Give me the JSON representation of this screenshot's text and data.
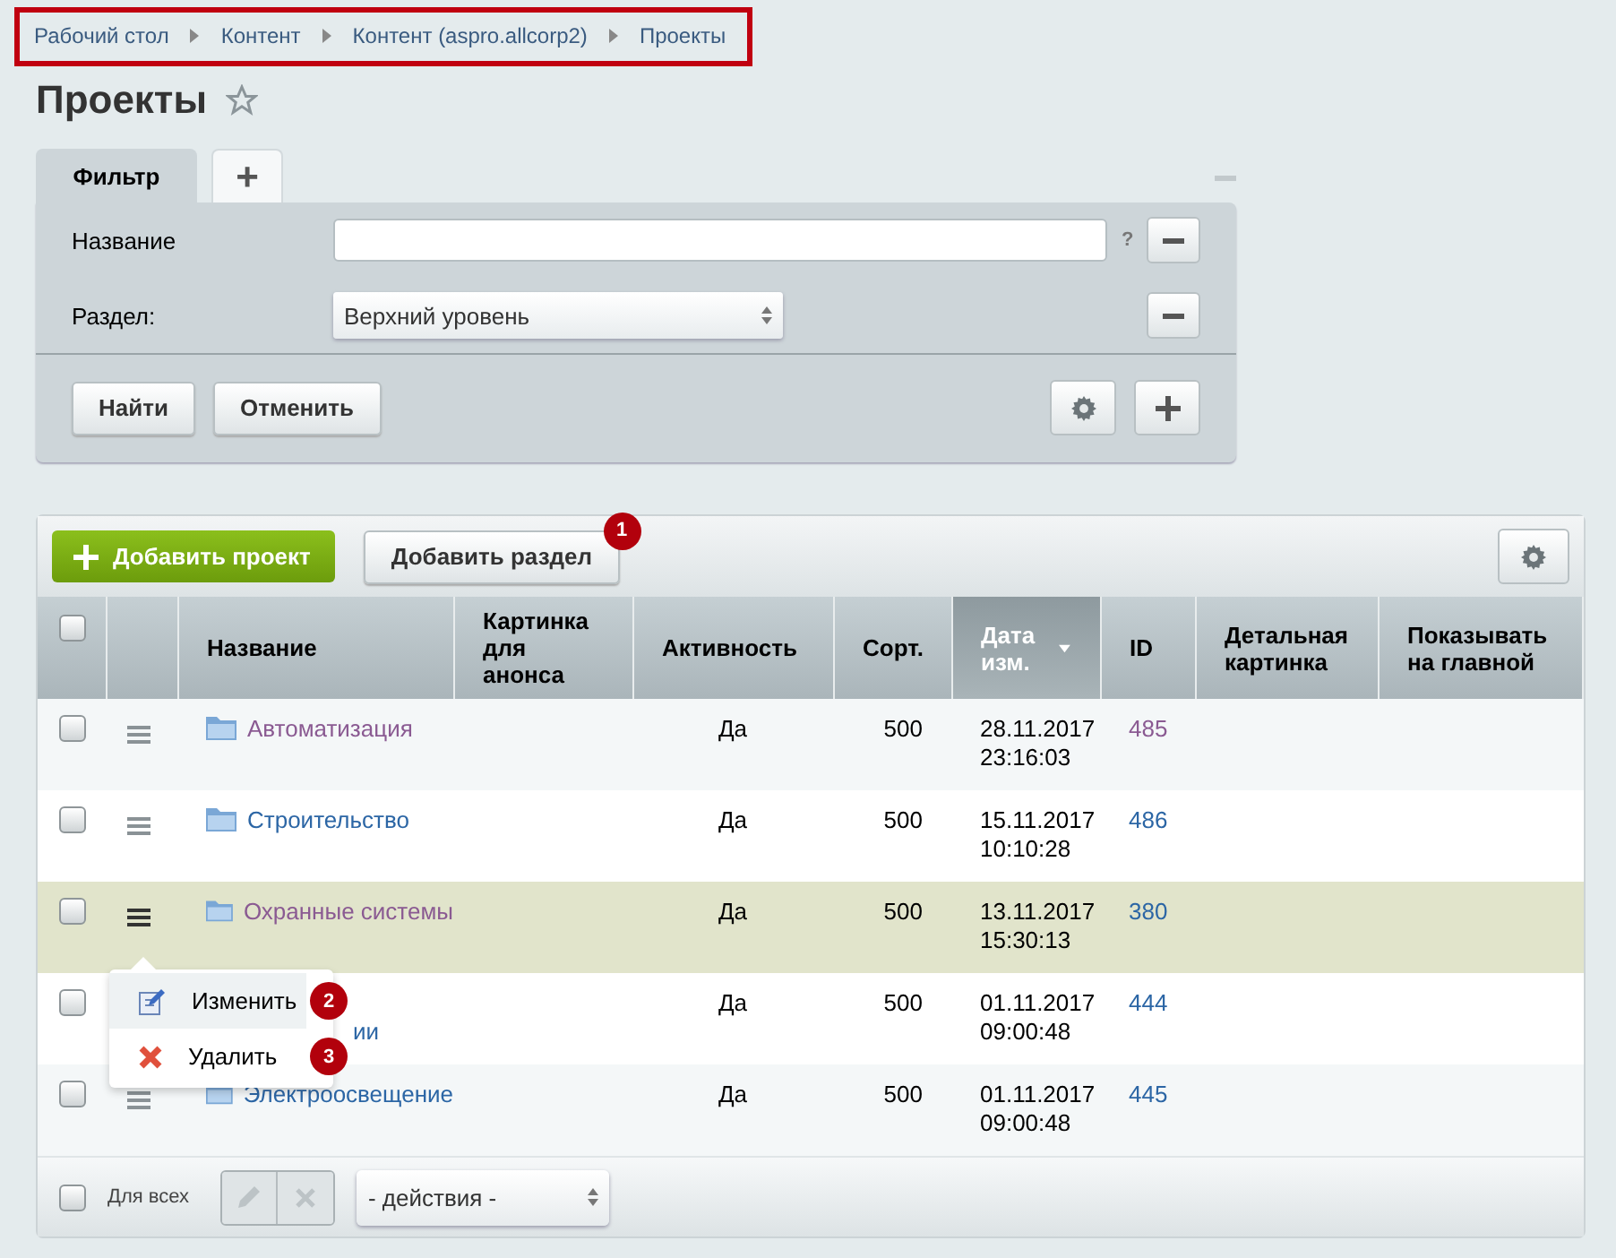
{
  "breadcrumbs": [
    "Рабочий стол",
    "Контент",
    "Контент (aspro.allcorp2)",
    "Проекты"
  ],
  "title": "Проекты",
  "filter": {
    "tabs": [
      {
        "label": "Фильтр",
        "selected": true
      },
      {
        "label": "+",
        "selected": false
      }
    ],
    "fields": [
      {
        "kind": "text",
        "label": "Название",
        "help": "?"
      },
      {
        "kind": "select",
        "label": "Раздел:",
        "value": "Верхний уровень"
      }
    ],
    "buttons": [
      "Найти",
      "Отменить"
    ]
  },
  "toolbar": {
    "add_button": "Добавить проект",
    "section_button": "Добавить раздел",
    "section_badge": "1"
  },
  "table": {
    "all_checked": false,
    "columns": [
      {
        "label": "Название",
        "sorted": false
      },
      {
        "label": "Картинка для анонса",
        "sorted": false
      },
      {
        "label": "Активность",
        "sorted": false
      },
      {
        "label": "Сорт.",
        "sorted": false
      },
      {
        "label": "Дата изм.",
        "sorted": true
      },
      {
        "label": "ID",
        "sorted": false
      },
      {
        "label": "Детальная картинка",
        "sorted": false
      },
      {
        "label": "Показывать на главной",
        "sorted": false
      }
    ],
    "rows": [
      {
        "name": "Автоматизация",
        "visited": true,
        "selected": false,
        "checked": false,
        "active": "Да",
        "sort": "500",
        "date": "28.11.2017",
        "time": "23:16:03",
        "id": "485",
        "id_visited": true
      },
      {
        "name": "Строительство",
        "visited": false,
        "selected": false,
        "checked": false,
        "active": "Да",
        "sort": "500",
        "date": "15.11.2017",
        "time": "10:10:28",
        "id": "486",
        "id_visited": false
      },
      {
        "name": "Охранные системы",
        "visited": true,
        "selected": true,
        "checked": false,
        "active": "Да",
        "sort": "500",
        "date": "13.11.2017",
        "time": "15:30:13",
        "id": "380",
        "id_visited": false
      },
      {
        "name": "ии",
        "visited": false,
        "selected": false,
        "checked": false,
        "covered": true,
        "active": "Да",
        "sort": "500",
        "date": "01.11.2017",
        "time": "09:00:48",
        "id": "444",
        "id_visited": false
      },
      {
        "name": "Электроосвещение",
        "visited": false,
        "selected": false,
        "checked": false,
        "active": "Да",
        "sort": "500",
        "date": "01.11.2017",
        "time": "09:00:48",
        "id": "445",
        "id_visited": false
      }
    ]
  },
  "context_menu": {
    "items": [
      {
        "kind": "edit",
        "label": "Изменить",
        "badge": "2"
      },
      {
        "kind": "delete",
        "label": "Удалить",
        "badge": "3"
      }
    ]
  },
  "footer": {
    "all_checked": false,
    "all_label": "Для всех",
    "actions": "- действия -"
  }
}
